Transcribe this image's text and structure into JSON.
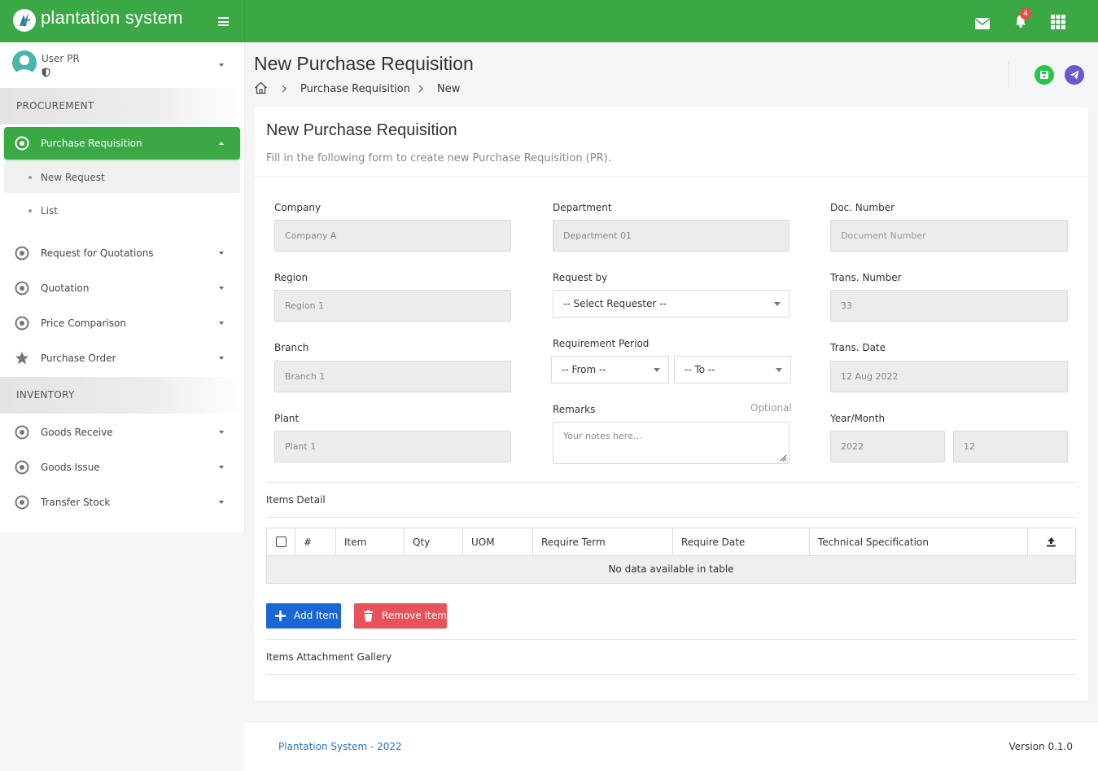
{
  "app": {
    "name": "plantation system",
    "notification_count": "4"
  },
  "user": {
    "name": "User PR"
  },
  "sidebar": {
    "sections": [
      {
        "label": "PROCUREMENT"
      },
      {
        "label": "INVENTORY"
      }
    ],
    "items": [
      {
        "label": "Purchase Requisition",
        "icon": "target-icon",
        "active": true
      },
      {
        "label": "Request for Quotations",
        "icon": "target-icon"
      },
      {
        "label": "Quotation",
        "icon": "target-icon"
      },
      {
        "label": "Price Comparison",
        "icon": "target-icon"
      },
      {
        "label": "Purchase Order",
        "icon": "star-icon"
      },
      {
        "label": "Goods Receive",
        "icon": "target-icon"
      },
      {
        "label": "Goods Issue",
        "icon": "target-icon"
      },
      {
        "label": "Transfer Stock",
        "icon": "target-icon"
      }
    ],
    "subitems": [
      {
        "label": "New Request",
        "current": true
      },
      {
        "label": "List"
      }
    ]
  },
  "page": {
    "title": "New Purchase Requisition",
    "breadcrumb": [
      "Purchase Requisition",
      "New"
    ]
  },
  "card": {
    "title": "New Purchase Requisition",
    "subtitle": "Fill in the following form to create new Purchase Requisition (PR)."
  },
  "form": {
    "company": {
      "label": "Company",
      "value": "Company A"
    },
    "region": {
      "label": "Region",
      "value": "Region 1"
    },
    "branch": {
      "label": "Branch",
      "value": "Branch 1"
    },
    "plant": {
      "label": "Plant",
      "value": "Plant 1"
    },
    "department": {
      "label": "Department",
      "value": "Department 01"
    },
    "request_by": {
      "label": "Request by",
      "value": "-- Select Requester --"
    },
    "requirement_period": {
      "label": "Requirement Period",
      "from": "-- From --",
      "to": "-- To --"
    },
    "remarks": {
      "label": "Remarks",
      "optional": "Optional",
      "placeholder": "Your notes here..."
    },
    "doc_number": {
      "label": "Doc. Number",
      "placeholder": "Document Number"
    },
    "trans_number": {
      "label": "Trans. Number",
      "value": "33"
    },
    "trans_date": {
      "label": "Trans. Date",
      "value": "12 Aug 2022"
    },
    "year_month": {
      "label": "Year/Month",
      "year": "2022",
      "month": "12"
    }
  },
  "items_detail": {
    "title": "Items Detail",
    "columns": [
      "#",
      "Item",
      "Qty",
      "UOM",
      "Require Term",
      "Require Date",
      "Technical Specification"
    ],
    "empty_text": "No data available in table",
    "add_label": "Add Item",
    "remove_label": "Remove Item"
  },
  "attachments": {
    "title": "Items Attachment Gallery"
  },
  "footer": {
    "left": "Plantation System - 2022",
    "right": "Version 0.1.0"
  },
  "colors": {
    "primary": "#3aa945",
    "blue": "#1a66d6",
    "red": "#e9525a",
    "purple": "#6a5acd"
  }
}
